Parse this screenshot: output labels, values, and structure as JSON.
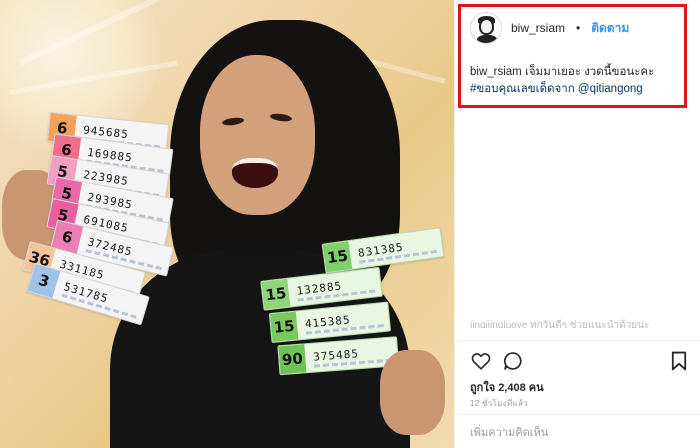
{
  "post": {
    "username": "biw_rsiam",
    "separator": "•",
    "follow_label": "ติดตาม",
    "caption": {
      "user": "biw_rsiam",
      "text": " เจ็มมาเยอะ งวดนี้ขอนะคะ ",
      "hashtag": "#ขอบคุณเลขเด็ดจาก",
      "mention": "@qitiangong"
    },
    "faded_comment": "jingjiingluoye   ทุกวันดีๆ ช่วยแนะนำด้วยนะ",
    "likes_text": "ถูกใจ 2,408 คน",
    "timestamp": "12 ชั่วโมงที่แล้ว",
    "comment_placeholder": "เพิ่มความคิดเห็น"
  },
  "icons": {
    "like": "heart-icon",
    "comment": "comment-bubble-icon",
    "save": "bookmark-icon"
  },
  "photo": {
    "tickets_left": [
      {
        "tab": "6",
        "number": "945685",
        "color": "#f5a15a"
      },
      {
        "tab": "6",
        "number": "169885",
        "color": "#f06d8b"
      },
      {
        "tab": "5",
        "number": "223985",
        "color": "#f29fc4"
      },
      {
        "tab": "5",
        "number": "293985",
        "color": "#e86aa8"
      },
      {
        "tab": "5",
        "number": "691085",
        "color": "#e95fa0"
      },
      {
        "tab": "6",
        "number": "372485",
        "color": "#ee7fb6"
      },
      {
        "tab": "36",
        "number": "331185",
        "color": "#f5c49a"
      },
      {
        "tab": "3",
        "number": "531785",
        "color": "#9fc3e6"
      }
    ],
    "tickets_right": [
      {
        "tab": "15",
        "number": "831385",
        "color": "#7fcf6a"
      },
      {
        "tab": "15",
        "number": "132885",
        "color": "#8fd67a"
      },
      {
        "tab": "15",
        "number": "415385",
        "color": "#79c961"
      },
      {
        "tab": "90",
        "number": "375485",
        "color": "#6fc457"
      }
    ]
  },
  "colors": {
    "link_blue": "#3897f0",
    "hashtag_blue": "#003569",
    "highlight_red": "#e0141b"
  }
}
